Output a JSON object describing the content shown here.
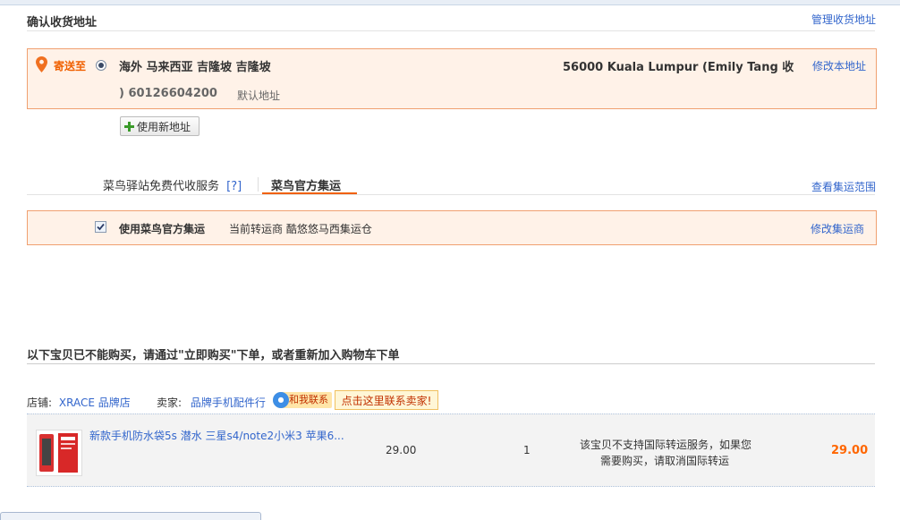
{
  "address_section": {
    "title": "确认收货地址",
    "manage_link": "管理收货地址",
    "ship_to_label": "寄送至",
    "address_line1": "海外 马来西亚 吉隆坡 吉隆坡",
    "address_line1b": "56000 Kuala Lumpur (Emily Tang 收",
    "address_line2": ") 60126604200",
    "default_tag": "默认地址",
    "edit_link": "修改本地址",
    "new_address_button": "使用新地址"
  },
  "shipping_tabs": {
    "tab1": "菜鸟驿站免费代收服务",
    "tab1_help": "[?]",
    "tab2": "菜鸟官方集运",
    "scope_link": "查看集运范围"
  },
  "consolidation": {
    "checkbox_label": "使用菜鸟官方集运",
    "current_forwarder": "当前转运商 酷悠悠马西集运仓",
    "edit_link": "修改集运商",
    "checked": true
  },
  "unavailable": {
    "heading": "以下宝贝已不能购买，请通过\"立即购买\"下单，或者重新加入购物车下单",
    "shop_label": "店铺:",
    "shop_name": "XRACE 品牌店",
    "seller_label": "卖家:",
    "seller_name": "品牌手机配件行",
    "contact_badge": "和我联系",
    "contact_tip": "点击这里联系卖家!",
    "item": {
      "title": "新款手机防水袋5s 潜水 三星s4/note2小米3 苹果6...",
      "price": "29.00",
      "quantity": "1",
      "notice_line1": "该宝贝不支持国际转运服务，如果您",
      "notice_line2": "需要购买，请取消国际转运",
      "subtotal": "29.00"
    }
  },
  "colors": {
    "link": "#3366cc",
    "box_bg": "#fff2e8",
    "box_border": "#f0a070",
    "accent_orange": "#f06000",
    "price_orange": "#ff6600"
  }
}
